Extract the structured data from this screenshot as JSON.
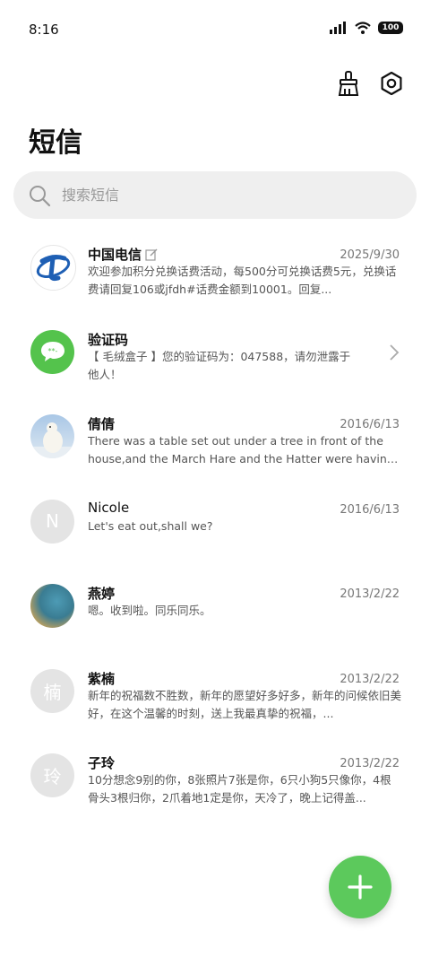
{
  "status": {
    "time": "8:16",
    "battery": "100"
  },
  "header": {
    "title": "短信"
  },
  "search": {
    "placeholder": "搜索短信"
  },
  "messages": [
    {
      "name": "中国电信",
      "date": "2025/9/30",
      "preview": "欢迎参加积分兑换话费活动，每500分可兑换话费5元，兑换话费请回复106或jfdh#话费金额到10001。回复..."
    },
    {
      "name": "验证码",
      "date": "",
      "preview": "【 毛绒盒子 】您的验证码为：047588，请勿泄露于他人！"
    },
    {
      "name": "倩倩",
      "date": "2016/6/13",
      "preview": "There was a table set out under a tree in front of the house,and the March Hare and the Hatter were having te..."
    },
    {
      "name": "Nicole",
      "date": "2016/6/13",
      "preview": "Let's eat out,shall we?",
      "initial": "N"
    },
    {
      "name": "燕婷",
      "date": "2013/2/22",
      "preview": "嗯。收到啦。同乐同乐。"
    },
    {
      "name": "紫楠",
      "date": "2013/2/22",
      "preview": "新年的祝福数不胜数，新年的愿望好多好多，新年的问候依旧美好，在这个温馨的时刻，送上我最真挚的祝福，...",
      "initial": "楠"
    },
    {
      "name": "子玲",
      "date": "2013/2/22",
      "preview": "10分想念9别的你，8张照片7张是你，6只小狗5只像你，4根骨头3根归你，2爪着地1定是你，天冷了，晚上记得盖...",
      "initial": "玲"
    }
  ],
  "colors": {
    "accent": "#5cc95c",
    "telecom_blue": "#1e5fb4",
    "sms_green": "#54c34c"
  }
}
